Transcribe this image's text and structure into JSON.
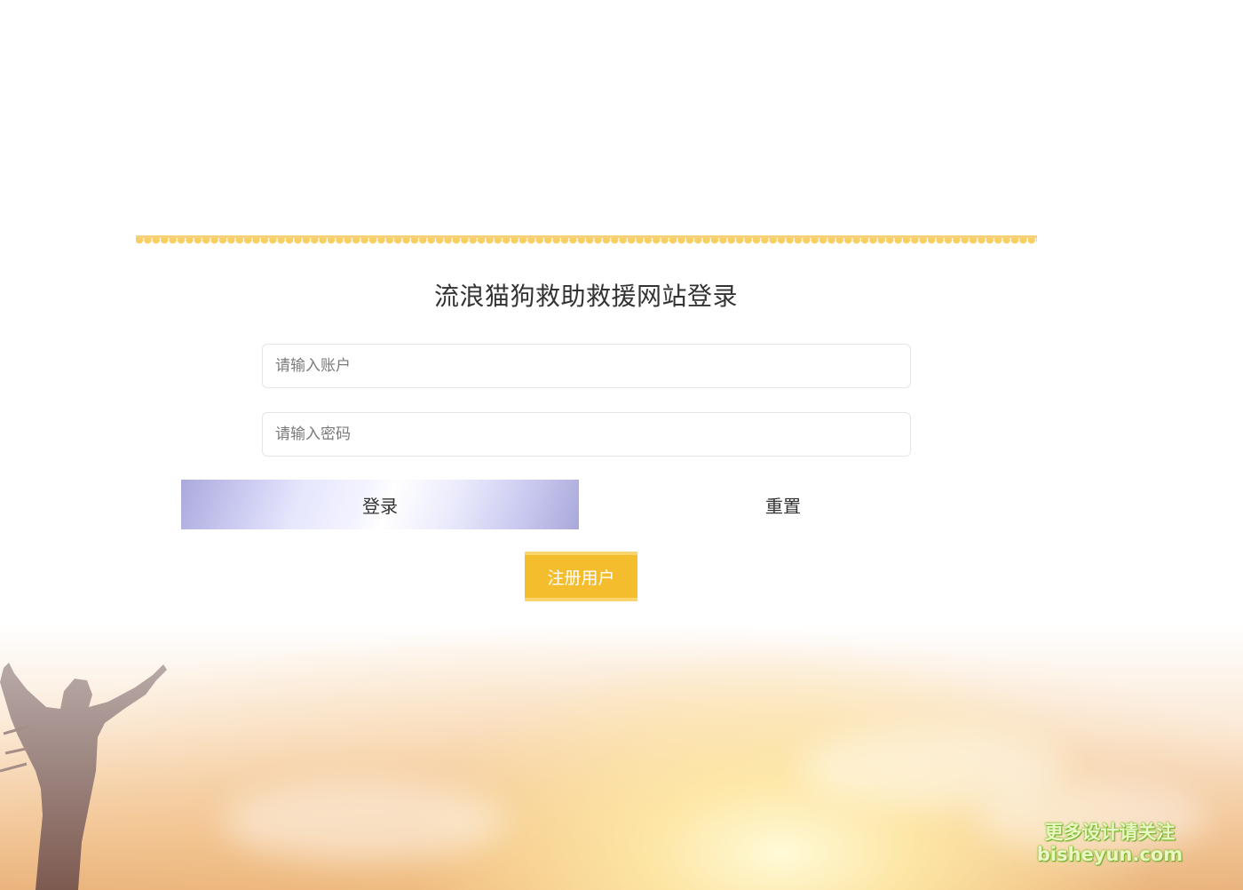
{
  "page": {
    "title": "流浪猫狗救助救援网站登录"
  },
  "form": {
    "account_placeholder": "请输入账户",
    "password_placeholder": "请输入密码",
    "login_label": "登录",
    "reset_label": "重置",
    "register_label": "注册用户"
  },
  "watermark": {
    "line1": "更多设计请关注",
    "line2": "bisheyun.com"
  },
  "colors": {
    "register_button": "#f4bd2d",
    "awning": "#f7cf63",
    "login_gradient_edge": "#aaa9dc"
  }
}
